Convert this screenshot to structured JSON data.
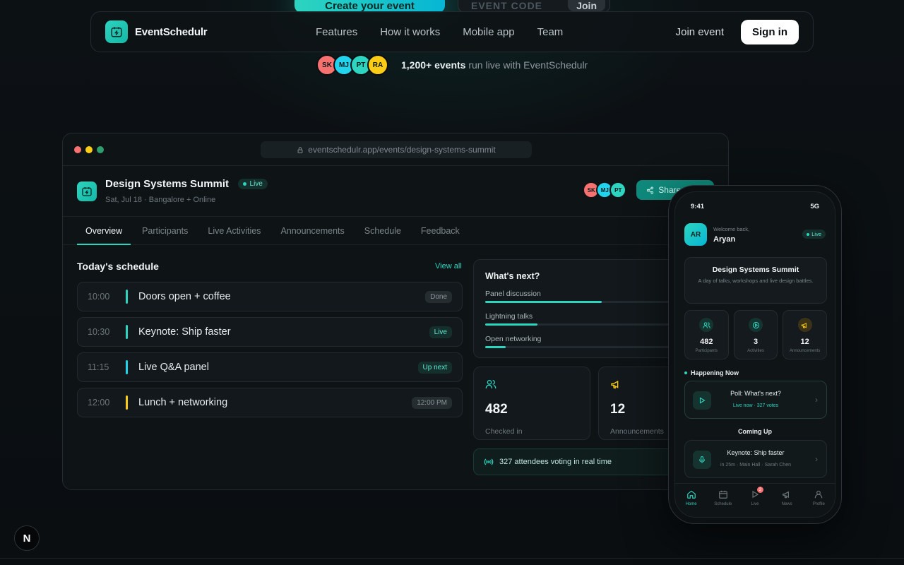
{
  "cta": {
    "primary_label": "Create your event",
    "code_placeholder": "EVENT CODE",
    "join_label": "Join"
  },
  "nav": {
    "brand": "EventSchedulr",
    "links": [
      "Features",
      "How it works",
      "Mobile app",
      "Team"
    ],
    "join_event": "Join event",
    "sign_in": "Sign in"
  },
  "proof": {
    "avatars": [
      {
        "initials": "SK",
        "color": "#f87171"
      },
      {
        "initials": "MJ",
        "color": "#22d3ee"
      },
      {
        "initials": "PT",
        "color": "#2dd4bf"
      },
      {
        "initials": "RA",
        "color": "#facc15"
      }
    ],
    "count": "1,200+ events",
    "text": "run live with EventSchedulr"
  },
  "browser": {
    "url": "eventschedulr.app/events/design-systems-summit",
    "dots": [
      "#f87171",
      "#facc15",
      "#2f9e6e"
    ]
  },
  "event": {
    "title": "Design Systems Summit",
    "live": "Live",
    "subtitle": "Sat, Jul 18 · Bangalore + Online",
    "share": "Share event",
    "attendees": [
      {
        "initials": "SK",
        "color": "#f87171"
      },
      {
        "initials": "MJ",
        "color": "#22d3ee"
      },
      {
        "initials": "PT",
        "color": "#2dd4bf"
      }
    ]
  },
  "tabs": [
    "Overview",
    "Participants",
    "Live Activities",
    "Announcements",
    "Schedule",
    "Feedback"
  ],
  "schedule": {
    "title": "Today's schedule",
    "view_all": "View all",
    "items": [
      {
        "time": "10:00",
        "title": "Doors open + coffee",
        "badge": "Done",
        "bar": "#2dd4bf",
        "badge_bg": "#262d31",
        "badge_fg": "#8a959a"
      },
      {
        "time": "10:30",
        "title": "Keynote: Ship faster",
        "badge": "Live",
        "bar": "#2dd4bf",
        "badge_bg": "#15302c",
        "badge_fg": "#5eead4"
      },
      {
        "time": "11:15",
        "title": "Live Q&A panel",
        "badge": "Up next",
        "bar": "#22d3ee",
        "badge_bg": "#15302c",
        "badge_fg": "#5eead4"
      },
      {
        "time": "12:00",
        "title": "Lunch + networking",
        "badge": "12:00 PM",
        "bar": "#facc15",
        "badge_bg": "#262d31",
        "badge_fg": "#8a959a"
      }
    ]
  },
  "whats_next": {
    "title": "What's next?",
    "items": [
      {
        "label": "Panel discussion",
        "progress": 0.62
      },
      {
        "label": "Lightning talks",
        "progress": 0.28
      },
      {
        "label": "Open networking",
        "progress": 0.11
      }
    ]
  },
  "stats": [
    {
      "value": "482",
      "label": "Checked in",
      "icon": "users-icon"
    },
    {
      "value": "12",
      "label": "Announcements",
      "icon": "megaphone-icon"
    }
  ],
  "voting": "327 attendees voting in real time",
  "phone": {
    "time": "9:41",
    "network": "5G",
    "avatar": "AR",
    "welcome": "Welcome back,",
    "name": "Aryan",
    "live": "Live",
    "card_title": "Design Systems Summit",
    "card_sub": "A day of talks, workshops and live design battles.",
    "stats": [
      {
        "value": "482",
        "label": "Participants"
      },
      {
        "value": "3",
        "label": "Activities"
      },
      {
        "value": "12",
        "label": "Announcements"
      }
    ],
    "happening_title": "Happening Now",
    "happening": {
      "title": "Poll: What's next?",
      "sub": "Live now · 327 votes"
    },
    "coming_title": "Coming Up",
    "coming": {
      "title": "Keynote: Ship faster",
      "sub": "in 25m · Main Hall · Sarah Chen"
    },
    "tabs": [
      "Home",
      "Schedule",
      "Live",
      "News",
      "Profile"
    ],
    "live_badge_count": "2"
  },
  "next_badge": "N"
}
